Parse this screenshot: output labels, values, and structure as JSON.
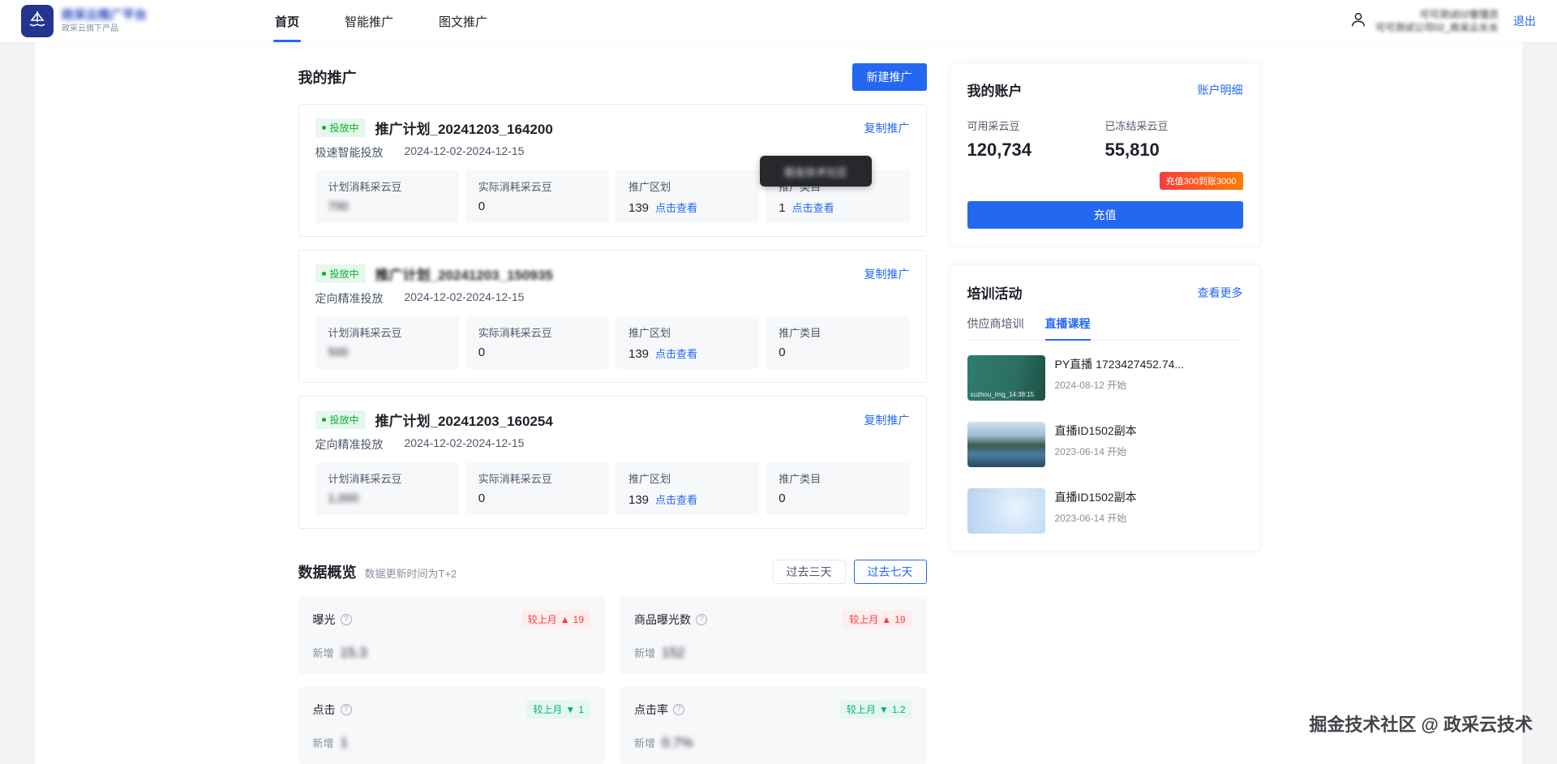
{
  "navbar": {
    "brand_title": "政采云推广平台",
    "brand_subtitle": "政采云旗下产品",
    "items": [
      {
        "label": "首页"
      },
      {
        "label": "智能推广"
      },
      {
        "label": "图文推广"
      }
    ],
    "user_line1": "可可测试02管理员",
    "user_line2": "可可测试公司02_政采云长长",
    "logout_label": "退出"
  },
  "promotions": {
    "section_title": "我的推广",
    "new_button": "新建推广",
    "copy_link": "复制推广",
    "status": "投放中",
    "view_link": "点击查看",
    "cards": [
      {
        "title": "推广计划_20241203_164200",
        "mode": "极速智能投放",
        "date_range": "2024-12-02-2024-12-15",
        "stats": [
          {
            "label": "计划消耗采云豆",
            "value": "700"
          },
          {
            "label": "实际消耗采云豆",
            "value": "0"
          },
          {
            "label": "推广区划",
            "value": "139"
          },
          {
            "label": "推广类目",
            "value": "1"
          }
        ]
      },
      {
        "title": "推广计划_20241203_150935",
        "mode": "定向精准投放",
        "date_range": "2024-12-02-2024-12-15",
        "stats": [
          {
            "label": "计划消耗采云豆",
            "value": "500"
          },
          {
            "label": "实际消耗采云豆",
            "value": "0"
          },
          {
            "label": "推广区划",
            "value": "139"
          },
          {
            "label": "推广类目",
            "value": "0"
          }
        ]
      },
      {
        "title": "推广计划_20241203_160254",
        "mode": "定向精准投放",
        "date_range": "2024-12-02-2024-12-15",
        "stats": [
          {
            "label": "计划消耗采云豆",
            "value": "1,000"
          },
          {
            "label": "实际消耗采云豆",
            "value": "0"
          },
          {
            "label": "推广区划",
            "value": "139"
          },
          {
            "label": "推广类目",
            "value": "0"
          }
        ]
      }
    ]
  },
  "overview": {
    "section_title": "数据概览",
    "subtitle": "数据更新时间为T+2",
    "ranges": [
      {
        "label": "过去三天"
      },
      {
        "label": "过去七天"
      }
    ],
    "cards": [
      {
        "label": "曝光",
        "badge_prefix": "较上月",
        "arrow": "▲",
        "delta": "19",
        "new_label": "新增",
        "value": "15.3"
      },
      {
        "label": "商品曝光数",
        "badge_prefix": "较上月",
        "arrow": "▲",
        "delta": "19",
        "new_label": "新增",
        "value": "152"
      },
      {
        "label": "点击",
        "badge_prefix": "较上月",
        "arrow": "▼",
        "delta": "1",
        "new_label": "新增",
        "value": "1"
      },
      {
        "label": "点击率",
        "badge_prefix": "较上月",
        "arrow": "▼",
        "delta": "1.2",
        "new_label": "新增",
        "value": "0.7%"
      }
    ]
  },
  "account": {
    "title": "我的账户",
    "detail_link": "账户明细",
    "available_label": "可用采云豆",
    "available_value": "120,734",
    "frozen_label": "已冻结采云豆",
    "frozen_value": "55,810",
    "ribbon": "充值300到账3000",
    "recharge_button": "充值"
  },
  "training": {
    "title": "培训活动",
    "more_link": "查看更多",
    "tabs": [
      {
        "label": "供应商培训"
      },
      {
        "label": "直播课程"
      }
    ],
    "items": [
      {
        "thumb_caption": "xuzhou_img_14:38:15",
        "title": "PY直播 1723427452.74...",
        "date": "2024-08-12 开始"
      },
      {
        "thumb_caption": "",
        "title": "直播ID1502副本",
        "date": "2023-06-14 开始"
      },
      {
        "thumb_caption": "",
        "title": "直播ID1502副本",
        "date": "2023-06-14 开始"
      }
    ]
  },
  "tooltip_text": "掘金技术社区",
  "watermark": "掘金技术社区 @ 政采云技术",
  "colors": {
    "primary": "#2468f2",
    "success": "#00b42a",
    "danger": "#f53f3f",
    "positive": "#00b578",
    "ribbon": "#ff6324"
  }
}
